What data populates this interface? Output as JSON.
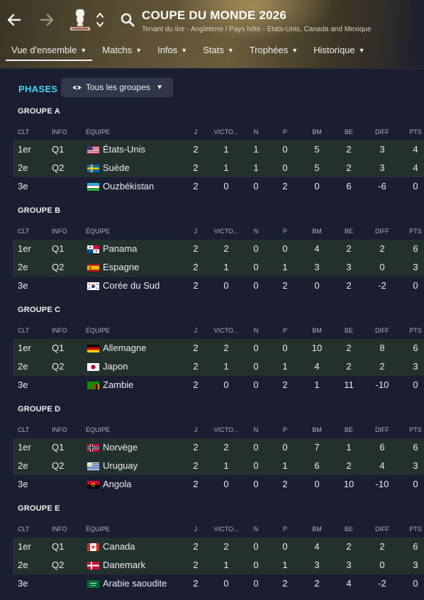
{
  "header": {
    "title": "COUPE DU MONDE 2026",
    "subtitle": "Tenant du tire - Angleterre / Pays hôte - États-Unis, Canada and Mexique",
    "back_icon": "arrow-left-icon",
    "forward_icon": "arrow-right-icon",
    "search_icon": "search-icon",
    "switcher_icon": "updown-chevron-icon",
    "tabs": [
      {
        "label": "Vue d'ensemble",
        "active": true
      },
      {
        "label": "Matchs"
      },
      {
        "label": "Infos"
      },
      {
        "label": "Stats"
      },
      {
        "label": "Trophées"
      },
      {
        "label": "Historique"
      }
    ]
  },
  "filter": {
    "section_label": "PHASES",
    "groups_filter": "Tous les groupes",
    "eye_icon": "eye-icon"
  },
  "columns": {
    "clt": "CLT",
    "info": "INFO",
    "team": "ÉQUIPE",
    "j": "J",
    "v": "VICTO...",
    "n": "N",
    "p": "P",
    "bm": "BM",
    "be": "BE",
    "diff": "DIFF",
    "pts": "PTS"
  },
  "groups": [
    {
      "title": "GROUPE A",
      "rows": [
        {
          "clt": "1er",
          "info": "Q1",
          "team": "États-Unis",
          "flag": "usa",
          "j": "2",
          "v": "1",
          "n": "1",
          "p": "0",
          "bm": "5",
          "be": "2",
          "diff": "3",
          "pts": "4"
        },
        {
          "clt": "2e",
          "info": "Q2",
          "team": "Suède",
          "flag": "sweden",
          "j": "2",
          "v": "1",
          "n": "1",
          "p": "0",
          "bm": "5",
          "be": "2",
          "diff": "3",
          "pts": "4"
        },
        {
          "clt": "3e",
          "info": "",
          "team": "Ouzbékistan",
          "flag": "uzbekistan",
          "j": "2",
          "v": "0",
          "n": "0",
          "p": "2",
          "bm": "0",
          "be": "6",
          "diff": "-6",
          "pts": "0"
        }
      ]
    },
    {
      "title": "GROUPE B",
      "rows": [
        {
          "clt": "1er",
          "info": "Q1",
          "team": "Panama",
          "flag": "panama",
          "j": "2",
          "v": "2",
          "n": "0",
          "p": "0",
          "bm": "4",
          "be": "2",
          "diff": "2",
          "pts": "6"
        },
        {
          "clt": "2e",
          "info": "Q2",
          "team": "Espagne",
          "flag": "spain",
          "j": "2",
          "v": "1",
          "n": "0",
          "p": "1",
          "bm": "3",
          "be": "3",
          "diff": "0",
          "pts": "3"
        },
        {
          "clt": "3e",
          "info": "",
          "team": "Corée du Sud",
          "flag": "korea",
          "j": "2",
          "v": "0",
          "n": "0",
          "p": "2",
          "bm": "0",
          "be": "2",
          "diff": "-2",
          "pts": "0"
        }
      ]
    },
    {
      "title": "GROUPE C",
      "rows": [
        {
          "clt": "1er",
          "info": "Q1",
          "team": "Allemagne",
          "flag": "germany",
          "j": "2",
          "v": "2",
          "n": "0",
          "p": "0",
          "bm": "10",
          "be": "2",
          "diff": "8",
          "pts": "6"
        },
        {
          "clt": "2e",
          "info": "Q2",
          "team": "Japon",
          "flag": "japan",
          "j": "2",
          "v": "1",
          "n": "0",
          "p": "1",
          "bm": "4",
          "be": "2",
          "diff": "2",
          "pts": "3"
        },
        {
          "clt": "3e",
          "info": "",
          "team": "Zambie",
          "flag": "zambia",
          "j": "2",
          "v": "0",
          "n": "0",
          "p": "2",
          "bm": "1",
          "be": "11",
          "diff": "-10",
          "pts": "0"
        }
      ]
    },
    {
      "title": "GROUPE D",
      "rows": [
        {
          "clt": "1er",
          "info": "Q1",
          "team": "Norvège",
          "flag": "norway",
          "j": "2",
          "v": "2",
          "n": "0",
          "p": "0",
          "bm": "7",
          "be": "1",
          "diff": "6",
          "pts": "6"
        },
        {
          "clt": "2e",
          "info": "Q2",
          "team": "Uruguay",
          "flag": "uruguay",
          "j": "2",
          "v": "1",
          "n": "0",
          "p": "1",
          "bm": "6",
          "be": "2",
          "diff": "4",
          "pts": "3"
        },
        {
          "clt": "3e",
          "info": "",
          "team": "Angola",
          "flag": "angola",
          "j": "2",
          "v": "0",
          "n": "0",
          "p": "2",
          "bm": "0",
          "be": "10",
          "diff": "-10",
          "pts": "0"
        }
      ]
    },
    {
      "title": "GROUPE E",
      "rows": [
        {
          "clt": "1er",
          "info": "Q1",
          "team": "Canada",
          "flag": "canada",
          "j": "2",
          "v": "2",
          "n": "0",
          "p": "0",
          "bm": "4",
          "be": "2",
          "diff": "2",
          "pts": "6"
        },
        {
          "clt": "2e",
          "info": "Q2",
          "team": "Danemark",
          "flag": "denmark",
          "j": "2",
          "v": "1",
          "n": "0",
          "p": "1",
          "bm": "3",
          "be": "3",
          "diff": "0",
          "pts": "3"
        },
        {
          "clt": "3e",
          "info": "",
          "team": "Arabie saoudite",
          "flag": "saudi",
          "j": "2",
          "v": "0",
          "n": "0",
          "p": "2",
          "bm": "2",
          "be": "4",
          "diff": "-2",
          "pts": "0"
        }
      ]
    }
  ]
}
